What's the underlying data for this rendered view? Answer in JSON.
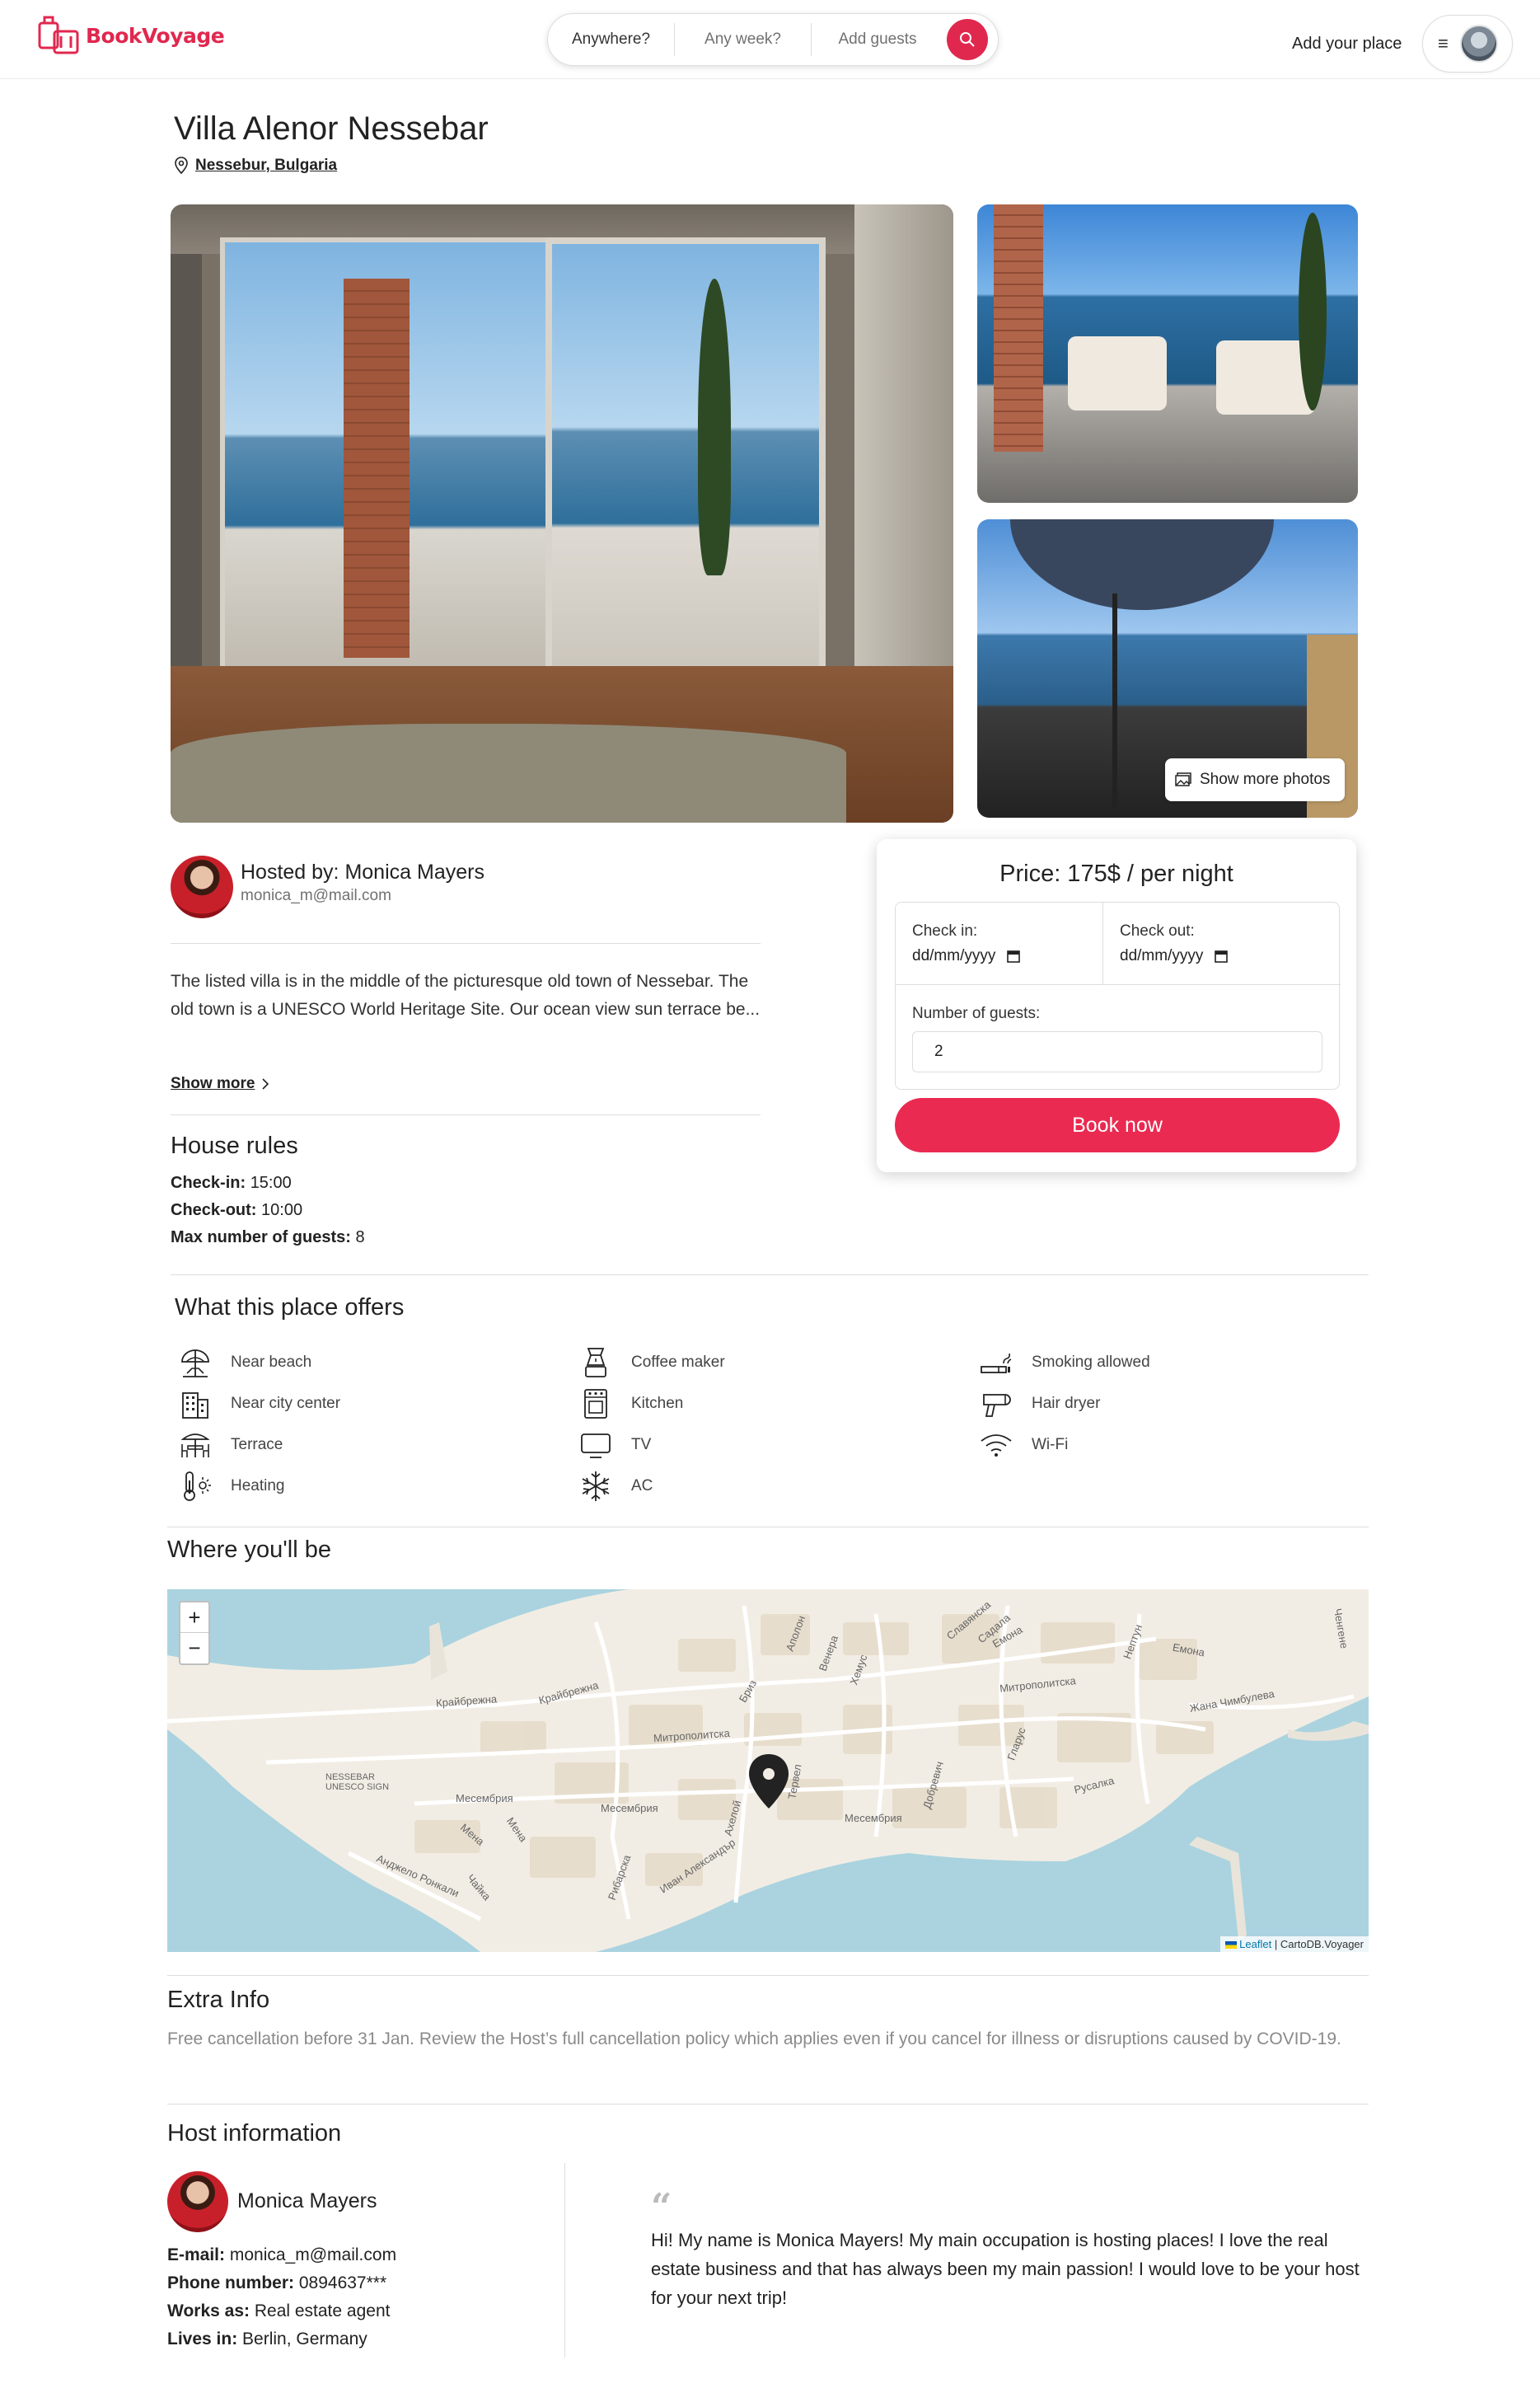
{
  "header": {
    "brand": "BookVoyage",
    "search": {
      "where": "Anywhere?",
      "when": "Any week?",
      "guests": "Add guests"
    },
    "add_place": "Add your place",
    "menu_icon": "≡"
  },
  "listing": {
    "title": "Villa Alenor Nessebar",
    "location": "Nessebur, Bulgaria",
    "show_more_photos": "Show more photos",
    "host": {
      "label": "Hosted by: Monica Mayers",
      "email": "monica_m@mail.com"
    },
    "description": "The listed villa is in the middle of the picturesque old town of Nessebar. The old town is a UNESCO World Heritage Site. Our ocean view sun terrace be...",
    "show_more": "Show more",
    "rules": {
      "title": "House rules",
      "checkin_label": "Check-in:",
      "checkin": "15:00",
      "checkout_label": "Check-out:",
      "checkout": "10:00",
      "max_label": "Max number of guests:",
      "max": "8"
    }
  },
  "booking": {
    "price": "Price: 175$ / per night",
    "checkin_label": "Check in:",
    "checkout_label": "Check out:",
    "date_placeholder": "dd/mm/yyyy",
    "guests_label": "Number of guests:",
    "guests_value": "2",
    "book_button": "Book now"
  },
  "offers": {
    "title": "What this place offers",
    "items": [
      {
        "label": "Near beach",
        "icon": "beach-umbrella-icon"
      },
      {
        "label": "Near city center",
        "icon": "building-icon"
      },
      {
        "label": "Terrace",
        "icon": "terrace-icon"
      },
      {
        "label": "Heating",
        "icon": "thermometer-icon"
      },
      {
        "label": "Coffee maker",
        "icon": "coffee-maker-icon"
      },
      {
        "label": "Kitchen",
        "icon": "stove-icon"
      },
      {
        "label": "TV",
        "icon": "tv-icon"
      },
      {
        "label": "AC",
        "icon": "snowflake-icon"
      },
      {
        "label": "Smoking allowed",
        "icon": "cigarette-icon"
      },
      {
        "label": "Hair dryer",
        "icon": "hair-dryer-icon"
      },
      {
        "label": "Wi-Fi",
        "icon": "wifi-icon"
      }
    ]
  },
  "map": {
    "title": "Where you'll be",
    "zoom_in": "+",
    "zoom_out": "−",
    "attribution_link": "Leaflet",
    "attribution_text": "| CartoDB.Voyager",
    "labels": [
      "Крайбрежна",
      "Крайбрежна",
      "Митрополитска",
      "Митрополитска",
      "Месембрия",
      "Месембрия",
      "Месембрия",
      "Месембрия",
      "NESSEBAR UNESCO SIGN",
      "Анджело Ронкали",
      "Иван Александър",
      "Рибарска",
      "Русалка",
      "Жана Чимбулева",
      "Емона",
      "Емона",
      "Нептун",
      "Хемус",
      "Венера",
      "Аполон",
      "Ахелой",
      "Бриз",
      "Гларус",
      "Ченгене",
      "Добревич",
      "Чайка",
      "Мена",
      "Мена",
      "Славянска",
      "Садала",
      "Тервел"
    ]
  },
  "extra": {
    "title": "Extra Info",
    "text": "Free cancellation before 31 Jan. Review the Host’s full cancellation policy which applies even if you cancel for illness or disruptions caused by COVID-19."
  },
  "host_info": {
    "title": "Host information",
    "name": "Monica Mayers",
    "email_label": "E-mail:",
    "email": "monica_m@mail.com",
    "phone_label": "Phone number:",
    "phone": "0894637***",
    "works_label": "Works as:",
    "works": "Real estate agent",
    "lives_label": "Lives in:",
    "lives": "Berlin, Germany",
    "quote_mark": "“",
    "quote": "Hi! My name is Monica Mayers! My main occupation is hosting places! I love the real estate business and that has always been my main passion! I would love to be your host for your next trip!"
  },
  "colors": {
    "brand": "#e0284f",
    "button": "#ea2a51",
    "sea": "#aad3df",
    "land": "#f2ede4"
  }
}
